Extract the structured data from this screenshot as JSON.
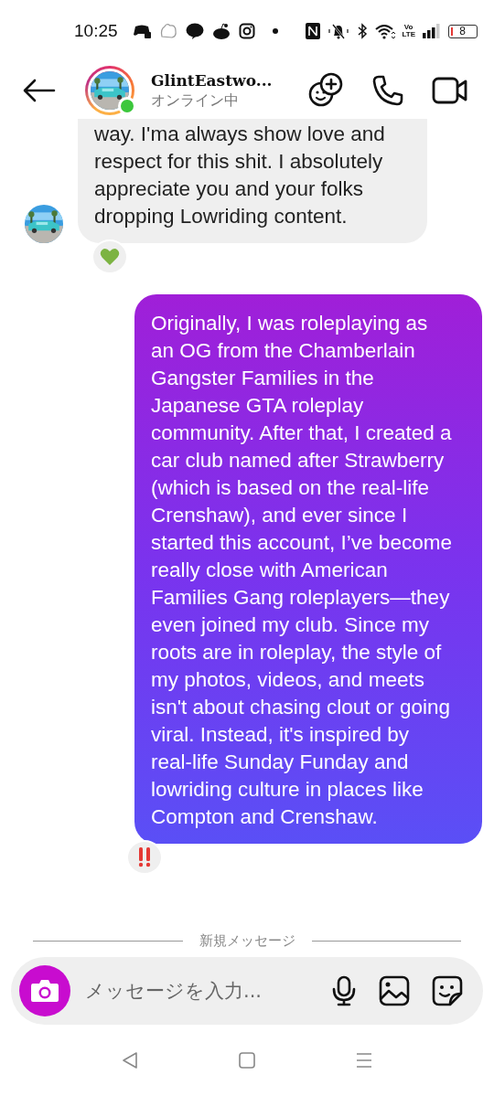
{
  "status_bar": {
    "time": "10:25",
    "network_label": "Vo LTE",
    "battery": "8"
  },
  "header": {
    "name": "GlintEastwo...",
    "subtitle": "オンライン中",
    "online": true
  },
  "messages": [
    {
      "kind": "incoming",
      "text": "way. I'ma always show love and respect for this shit. I absolutely appreciate you and your folks dropping Lowriding content.",
      "reaction": {
        "kind": "heart"
      }
    },
    {
      "kind": "outgoing",
      "text": "Originally, I was roleplaying as an OG from the Chamberlain Gangster Families in the Japanese GTA roleplay community. After that, I created a car club named after Strawberry (which is based on the real-life Crenshaw), and ever since I started this account, I’ve become really close with American Families Gang roleplayers—they even joined my club. Since my roots are in roleplay, the style of my photos, videos, and meets isn't about chasing clout or going viral. Instead, it's inspired by real-life Sunday Funday and lowriding culture in places like Compton and Crenshaw.",
      "reaction": {
        "kind": "exclamation"
      }
    }
  ],
  "divider": "新規メッセージ",
  "composer": {
    "placeholder": "メッセージを入力..."
  }
}
